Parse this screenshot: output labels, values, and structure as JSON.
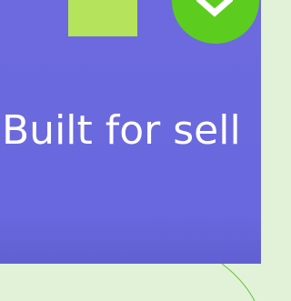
{
  "hero": {
    "headline": "Built for sell",
    "background_color": "#6b69dd",
    "square_color": "#b5e35b",
    "badge_color": "#5ccd1f",
    "badge_icon": "check-icon"
  },
  "below_section": {
    "background_color": "#e2f2d8",
    "accent_line_color": "#62c43a"
  }
}
